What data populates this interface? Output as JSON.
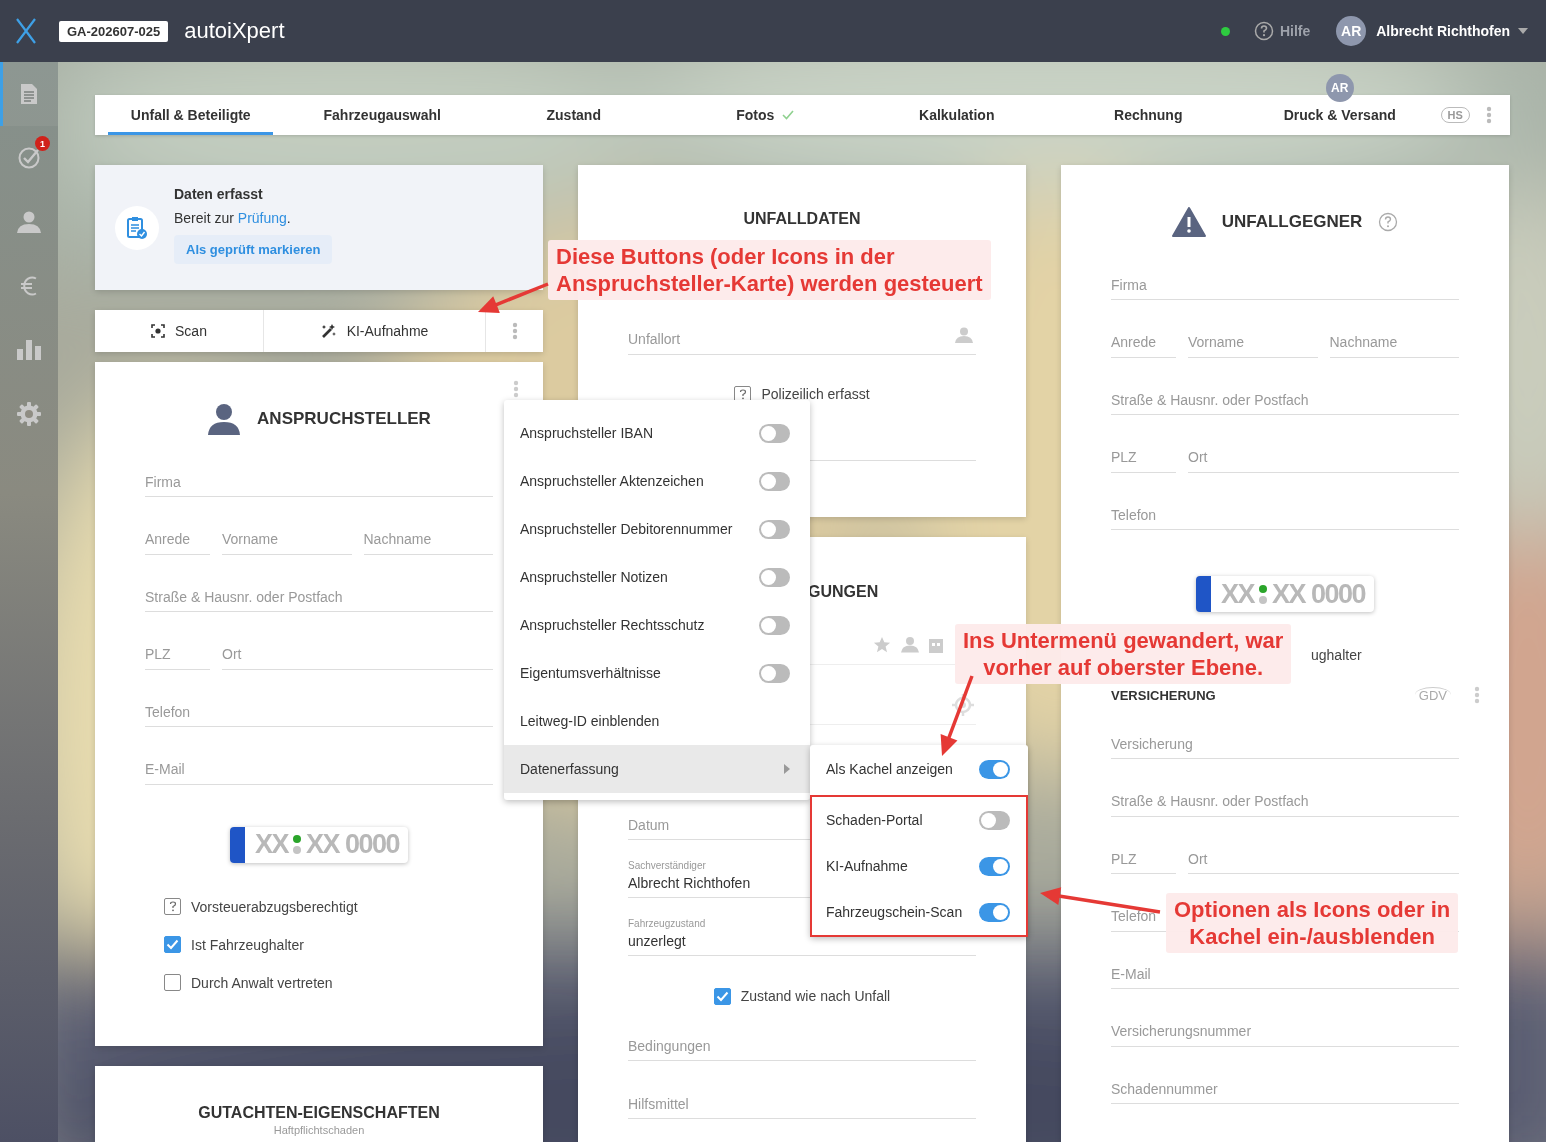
{
  "header": {
    "case_number": "GA-202607-025",
    "app_name": "autoiXpert",
    "online": true,
    "help": "Hilfe",
    "user_initials": "AR",
    "user_name": "Albrecht Richthofen"
  },
  "sidebar": {
    "items": [
      {
        "kind": "document",
        "selected": true
      },
      {
        "kind": "tasks",
        "selected": false,
        "badge": "1"
      },
      {
        "kind": "contacts",
        "selected": false
      },
      {
        "kind": "invoices",
        "selected": false
      },
      {
        "kind": "statistics",
        "selected": false
      },
      {
        "kind": "settings",
        "selected": false
      }
    ]
  },
  "tabs": [
    {
      "label": "Unfall & Beteiligte",
      "selected": true,
      "done": false
    },
    {
      "label": "Fahrzeugauswahl",
      "selected": false,
      "done": false
    },
    {
      "label": "Zustand",
      "selected": false,
      "done": false
    },
    {
      "label": "Fotos",
      "selected": false,
      "done": true
    },
    {
      "label": "Kalkulation",
      "selected": false,
      "done": false
    },
    {
      "label": "Rechnung",
      "selected": false,
      "done": false
    },
    {
      "label": "Druck & Versand",
      "selected": false,
      "done": false,
      "assignee": "AR"
    }
  ],
  "tab_badge": "HS",
  "status_card": {
    "title": "Daten erfasst",
    "text_before": "Bereit zur ",
    "link": "Prüfung",
    "text_after": ".",
    "button": "Als geprüft markieren"
  },
  "capture_bar": {
    "buttons": [
      {
        "kind": "scan",
        "label": "Scan"
      },
      {
        "kind": "ai",
        "label": "KI-Aufnahme"
      }
    ]
  },
  "claimant": {
    "title": "ANSPRUCHSTELLER",
    "rows": [
      [
        {
          "placeholder": "Firma"
        }
      ],
      [
        {
          "placeholder": "Anrede"
        },
        {
          "placeholder": "Vorname"
        },
        {
          "placeholder": "Nachname"
        }
      ],
      [
        {
          "placeholder": "Straße & Hausnr. oder Postfach"
        }
      ],
      [
        {
          "placeholder": "PLZ"
        },
        {
          "placeholder": "Ort"
        }
      ],
      [
        {
          "placeholder": "Telefon"
        }
      ],
      [
        {
          "placeholder": "E-Mail"
        }
      ]
    ],
    "plate": {
      "left": "XX",
      "right": "XX 0000"
    },
    "checkboxes": [
      {
        "label": "Vorsteuerabzugsberechtigt",
        "checked": false,
        "indeterminate": true
      },
      {
        "label": "Ist Fahrzeughalter",
        "checked": true,
        "indeterminate": false
      },
      {
        "label": "Durch Anwalt vertreten",
        "checked": false,
        "indeterminate": false
      }
    ]
  },
  "report_card": {
    "title": "GUTACHTEN-EIGENSCHAFTEN",
    "subtitle": "Haftpflichtschaden"
  },
  "accident_card": {
    "title": "UNFALLDATEN",
    "location": {
      "placeholder": "Unfallort"
    },
    "police": {
      "label": "Polizeilich erfasst",
      "checked": false,
      "indeterminate": true
    }
  },
  "damage_card": {
    "title": "GUNGEN",
    "date": {
      "placeholder": "Datum"
    },
    "expert": {
      "label": "Sachverständiger",
      "value": "Albrecht Richthofen"
    },
    "condition": {
      "label": "Fahrzeugzustand",
      "value": "unzerlegt"
    },
    "checkbox": {
      "label": "Zustand wie nach Unfall",
      "checked": true
    },
    "fields": [
      {
        "placeholder": "Bedingungen"
      },
      {
        "placeholder": "Hilfsmittel"
      }
    ]
  },
  "opponent": {
    "title": "UNFALLGEGNER",
    "rows": [
      [
        {
          "placeholder": "Firma"
        }
      ],
      [
        {
          "placeholder": "Anrede"
        },
        {
          "placeholder": "Vorname"
        },
        {
          "placeholder": "Nachname"
        }
      ],
      [
        {
          "placeholder": "Straße & Hausnr. oder Postfach"
        }
      ],
      [
        {
          "placeholder": "PLZ"
        },
        {
          "placeholder": "Ort"
        }
      ],
      [
        {
          "placeholder": "Telefon"
        }
      ]
    ],
    "plate": {
      "left": "XX",
      "right": "XX 0000"
    },
    "holder_label": "ughalter",
    "insurance_title": "VERSICHERUNG",
    "insurance_logo": "GDV",
    "insurance_rows": [
      [
        {
          "placeholder": "Versicherung"
        }
      ],
      [
        {
          "placeholder": "Straße & Hausnr. oder Postfach"
        }
      ],
      [
        {
          "placeholder": "PLZ"
        },
        {
          "placeholder": "Ort"
        }
      ],
      [
        {
          "placeholder": "Telefon"
        }
      ],
      [
        {
          "placeholder": "E-Mail"
        }
      ],
      [
        {
          "placeholder": "Versicherungsnummer"
        }
      ],
      [
        {
          "placeholder": "Schadennummer"
        }
      ]
    ]
  },
  "menu": {
    "items": [
      {
        "kind": "toggle",
        "label": "Anspruchsteller IBAN",
        "on": false
      },
      {
        "kind": "toggle",
        "label": "Anspruchsteller Aktenzeichen",
        "on": false
      },
      {
        "kind": "toggle",
        "label": "Anspruchsteller Debitorennummer",
        "on": false
      },
      {
        "kind": "toggle",
        "label": "Anspruchsteller Notizen",
        "on": false
      },
      {
        "kind": "toggle",
        "label": "Anspruchsteller Rechtsschutz",
        "on": false
      },
      {
        "kind": "toggle",
        "label": "Eigentumsverhältnisse",
        "on": false
      },
      {
        "kind": "action",
        "label": "Leitweg-ID einblenden"
      },
      {
        "kind": "submenu",
        "label": "Datenerfassung",
        "expanded": true
      }
    ]
  },
  "submenu": {
    "items": [
      {
        "label": "Als Kachel anzeigen",
        "on": true,
        "framed": false
      },
      {
        "label": "Schaden-Portal",
        "on": false,
        "framed": true
      },
      {
        "label": "KI-Aufnahme",
        "on": true,
        "framed": true
      },
      {
        "label": "Fahrzeugschein-Scan",
        "on": true,
        "framed": true
      }
    ]
  },
  "annotations": [
    {
      "text": "Diese Buttons (oder Icons in der\nAnspruchsteller-Karte) werden gesteuert"
    },
    {
      "text": "Ins Untermenü gewandert, war\nvorher auf oberster Ebene."
    },
    {
      "text": "Optionen als Icons oder in\nKachel ein-/ausblenden"
    }
  ]
}
